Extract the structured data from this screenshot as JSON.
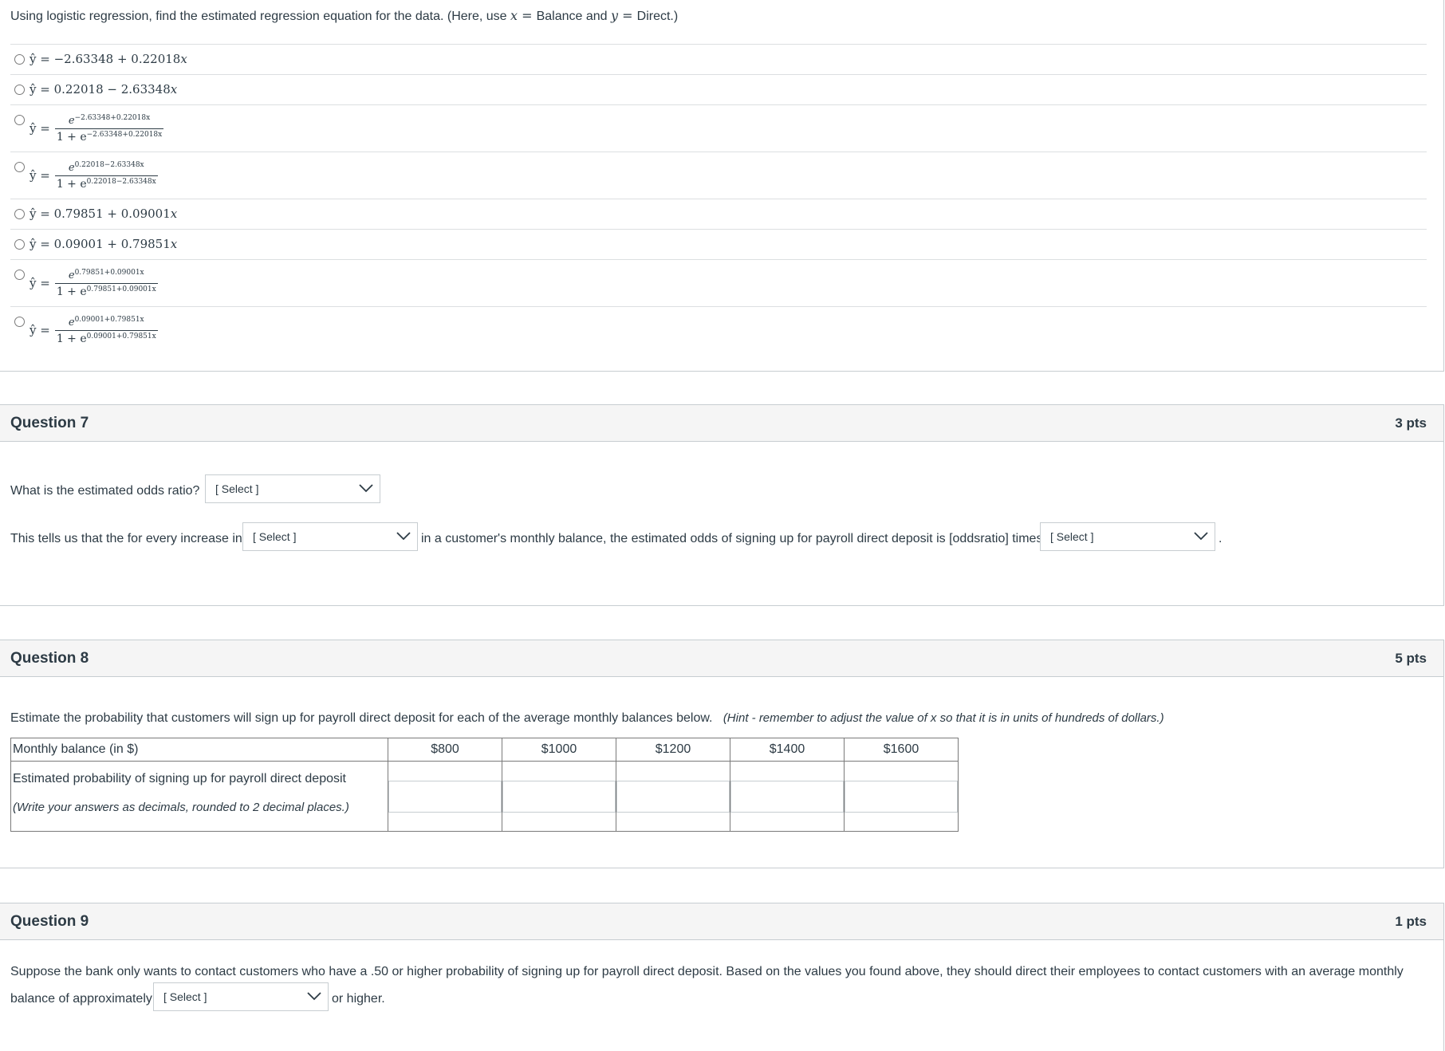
{
  "q6": {
    "prompt_pre": "Using logistic regression, find the estimated regression equation for the data.  (Here, use ",
    "x": "x",
    "eq1": " = ",
    "balance_and": "Balance and ",
    "y": "y",
    "eq2": " = ",
    "direct": "Direct.)",
    "options": [
      {
        "lhs": "ŷ = ",
        "rhs": "−2.63348 + 0.22018",
        "var": "x"
      },
      {
        "lhs": "ŷ = ",
        "rhs": "0.22018 − 2.63348",
        "var": "x"
      },
      {
        "lhs": "ŷ =",
        "num_base": "e",
        "num_exp": "−2.63348+0.22018x",
        "den_pre": "1 + e",
        "den_exp": "−2.63348+0.22018x"
      },
      {
        "lhs": "ŷ =",
        "num_base": "e",
        "num_exp": "0.22018−2.63348x",
        "den_pre": "1 + e",
        "den_exp": "0.22018−2.63348x"
      },
      {
        "lhs": "ŷ = ",
        "rhs": "0.79851 + 0.09001",
        "var": "x"
      },
      {
        "lhs": "ŷ = ",
        "rhs": "0.09001 + 0.79851",
        "var": "x"
      },
      {
        "lhs": "ŷ =",
        "num_base": "e",
        "num_exp": "0.79851+0.09001x",
        "den_pre": "1 + e",
        "den_exp": "0.79851+0.09001x"
      },
      {
        "lhs": "ŷ =",
        "num_base": "e",
        "num_exp": "0.09001+0.79851x",
        "den_pre": "1 + e",
        "den_exp": "0.09001+0.79851x"
      }
    ]
  },
  "q7": {
    "title": "Question 7",
    "pts": "3 pts",
    "odds_prompt": "What is the estimated odds ratio?",
    "select_label": "[ Select ]",
    "sentence_a": "This tells us that the for every increase in",
    "sentence_b": "in a customer's monthly balance, the estimated odds of signing up for payroll direct deposit is [oddsratio] times",
    "period": "."
  },
  "q8": {
    "title": "Question 8",
    "pts": "5 pts",
    "prompt": "Estimate the probability that customers will sign up for payroll direct deposit for each of the average monthly balances below.",
    "hint": "(Hint - remember to adjust the value of x so that it is in units of hundreds of dollars.)",
    "table": {
      "row_header": "Monthly balance (in $)",
      "columns": [
        "$800",
        "$1000",
        "$1200",
        "$1400",
        "$1600"
      ],
      "prob_label": "Estimated probability of signing up for payroll direct deposit",
      "prob_note": "(Write your answers as decimals, rounded to 2 decimal places.)"
    }
  },
  "q9": {
    "title": "Question 9",
    "pts": "1 pts",
    "line1": "Suppose the bank only wants to contact customers who have a .50 or higher probability of signing up for payroll direct deposit.  Based on the values you found above, they should direct their employees to contact customers with an average monthly",
    "line2_pre": "balance of approximately",
    "line2_post": "or higher.",
    "select_label": "[ Select ]"
  }
}
